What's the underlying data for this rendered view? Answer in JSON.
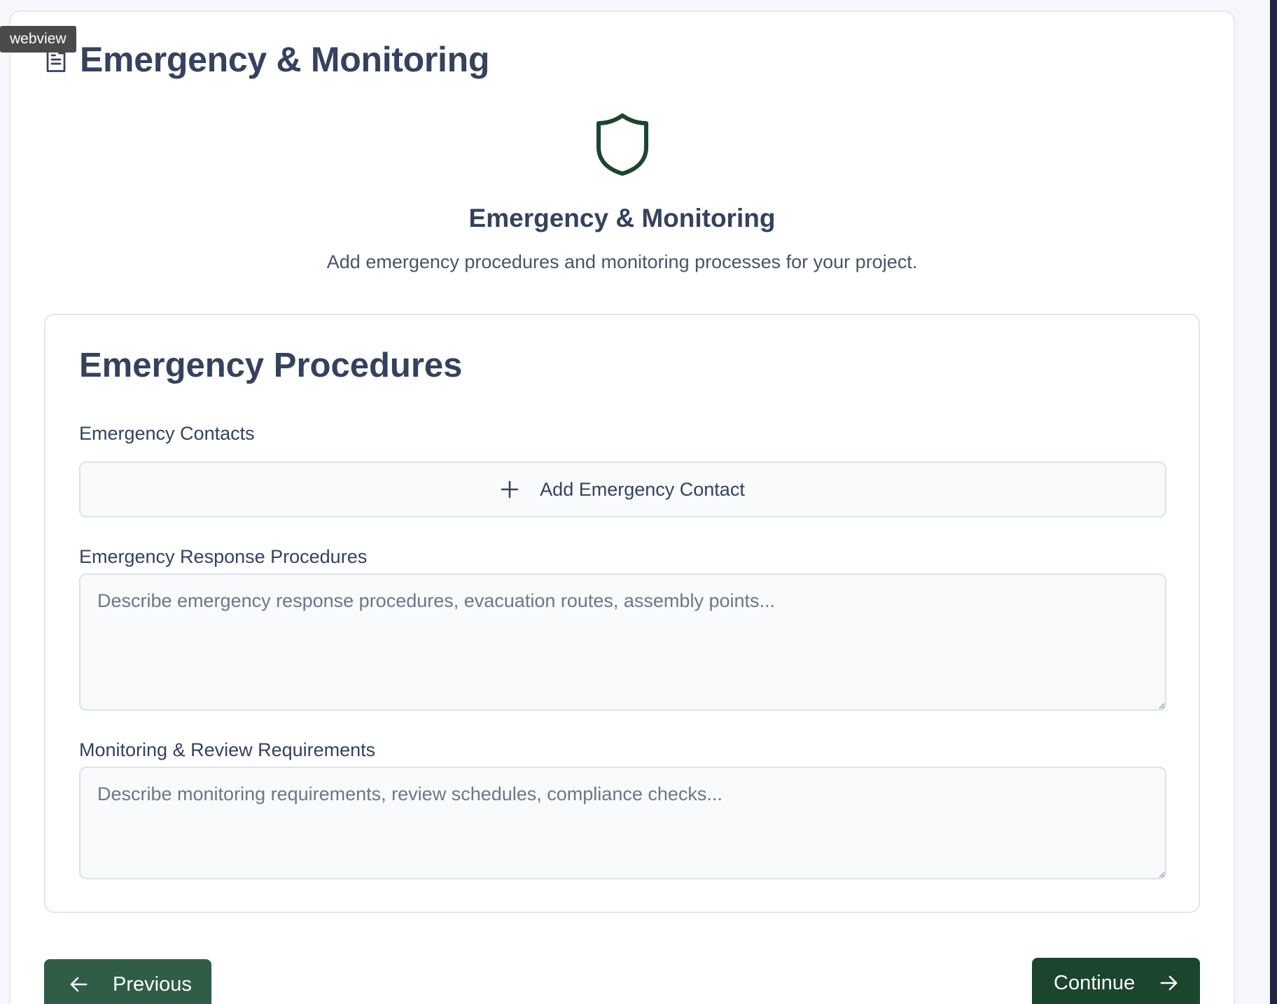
{
  "webview_tag": "webview",
  "header": {
    "icon": "document-icon",
    "title": "Emergency & Monitoring"
  },
  "hero": {
    "icon": "shield-icon",
    "title": "Emergency & Monitoring",
    "subtitle": "Add emergency procedures and monitoring processes for your project."
  },
  "section": {
    "title": "Emergency Procedures",
    "contacts": {
      "label": "Emergency Contacts",
      "add_icon": "plus-icon",
      "add_label": "Add Emergency Contact"
    },
    "response": {
      "label": "Emergency Response Procedures",
      "value": "",
      "placeholder": "Describe emergency response procedures, evacuation routes, assembly points..."
    },
    "monitoring": {
      "label": "Monitoring & Review Requirements",
      "value": "",
      "placeholder": "Describe monitoring requirements, review schedules, compliance checks..."
    }
  },
  "nav": {
    "previous_label": "Previous",
    "previous_icon": "arrow-left-icon",
    "continue_label": "Continue",
    "continue_icon": "arrow-right-icon"
  },
  "colors": {
    "heading": "#34425f",
    "accent_green": "#1c452e",
    "accent_green_light": "#2f5d45",
    "field_bg": "#f8fafc",
    "border": "#dde3ea"
  }
}
